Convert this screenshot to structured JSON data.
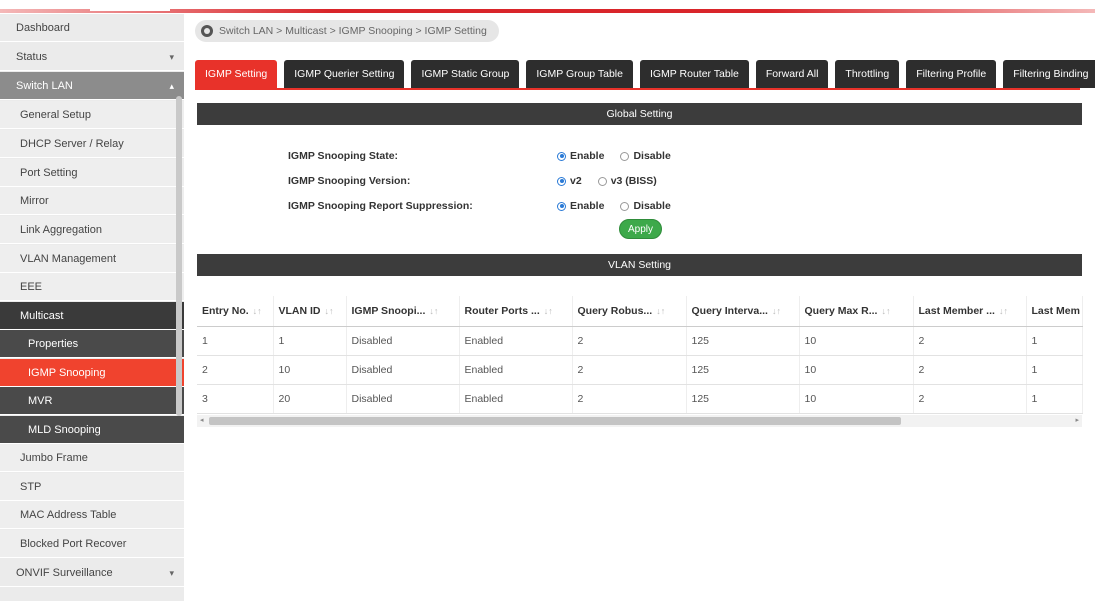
{
  "breadcrumb": "Switch LAN > Multicast > IGMP Snooping > IGMP Setting",
  "sidebar": {
    "items": [
      {
        "label": "Dashboard"
      },
      {
        "label": "Status"
      },
      {
        "label": "Switch LAN"
      },
      {
        "label": "General Setup"
      },
      {
        "label": "DHCP Server / Relay"
      },
      {
        "label": "Port Setting"
      },
      {
        "label": "Mirror"
      },
      {
        "label": "Link Aggregation"
      },
      {
        "label": "VLAN Management"
      },
      {
        "label": "EEE"
      },
      {
        "label": "Multicast"
      },
      {
        "label": "Properties"
      },
      {
        "label": "IGMP Snooping"
      },
      {
        "label": "MVR"
      },
      {
        "label": "MLD Snooping"
      },
      {
        "label": "Jumbo Frame"
      },
      {
        "label": "STP"
      },
      {
        "label": "MAC Address Table"
      },
      {
        "label": "Blocked Port Recover"
      },
      {
        "label": "ONVIF Surveillance"
      }
    ]
  },
  "tabs": [
    {
      "label": "IGMP Setting"
    },
    {
      "label": "IGMP Querier Setting"
    },
    {
      "label": "IGMP Static Group"
    },
    {
      "label": "IGMP Group Table"
    },
    {
      "label": "IGMP Router Table"
    },
    {
      "label": "Forward All"
    },
    {
      "label": "Throttling"
    },
    {
      "label": "Filtering Profile"
    },
    {
      "label": "Filtering Binding"
    }
  ],
  "global_setting": {
    "title": "Global Setting",
    "state_label": "IGMP Snooping State:",
    "version_label": "IGMP Snooping Version:",
    "suppression_label": "IGMP Snooping Report Suppression:",
    "enable": "Enable",
    "disable": "Disable",
    "v2": "v2",
    "v3": "v3 (BISS)",
    "state_value": "Enable",
    "version_value": "v2",
    "suppression_value": "Enable",
    "apply": "Apply"
  },
  "vlan_setting": {
    "title": "VLAN Setting",
    "columns": [
      "Entry No.",
      "VLAN ID",
      "IGMP Snoopi...",
      "Router Ports ...",
      "Query Robus...",
      "Query Interva...",
      "Query Max R...",
      "Last Member ...",
      "Last Mem"
    ],
    "rows": [
      [
        "1",
        "1",
        "Disabled",
        "Enabled",
        "2",
        "125",
        "10",
        "2",
        "1"
      ],
      [
        "2",
        "10",
        "Disabled",
        "Enabled",
        "2",
        "125",
        "10",
        "2",
        "1"
      ],
      [
        "3",
        "20",
        "Disabled",
        "Enabled",
        "2",
        "125",
        "10",
        "2",
        "1"
      ]
    ]
  },
  "colors": {
    "accent_red": "#e8322a",
    "apply_green": "#3da94a",
    "dark_bar": "#3c3c3c"
  }
}
